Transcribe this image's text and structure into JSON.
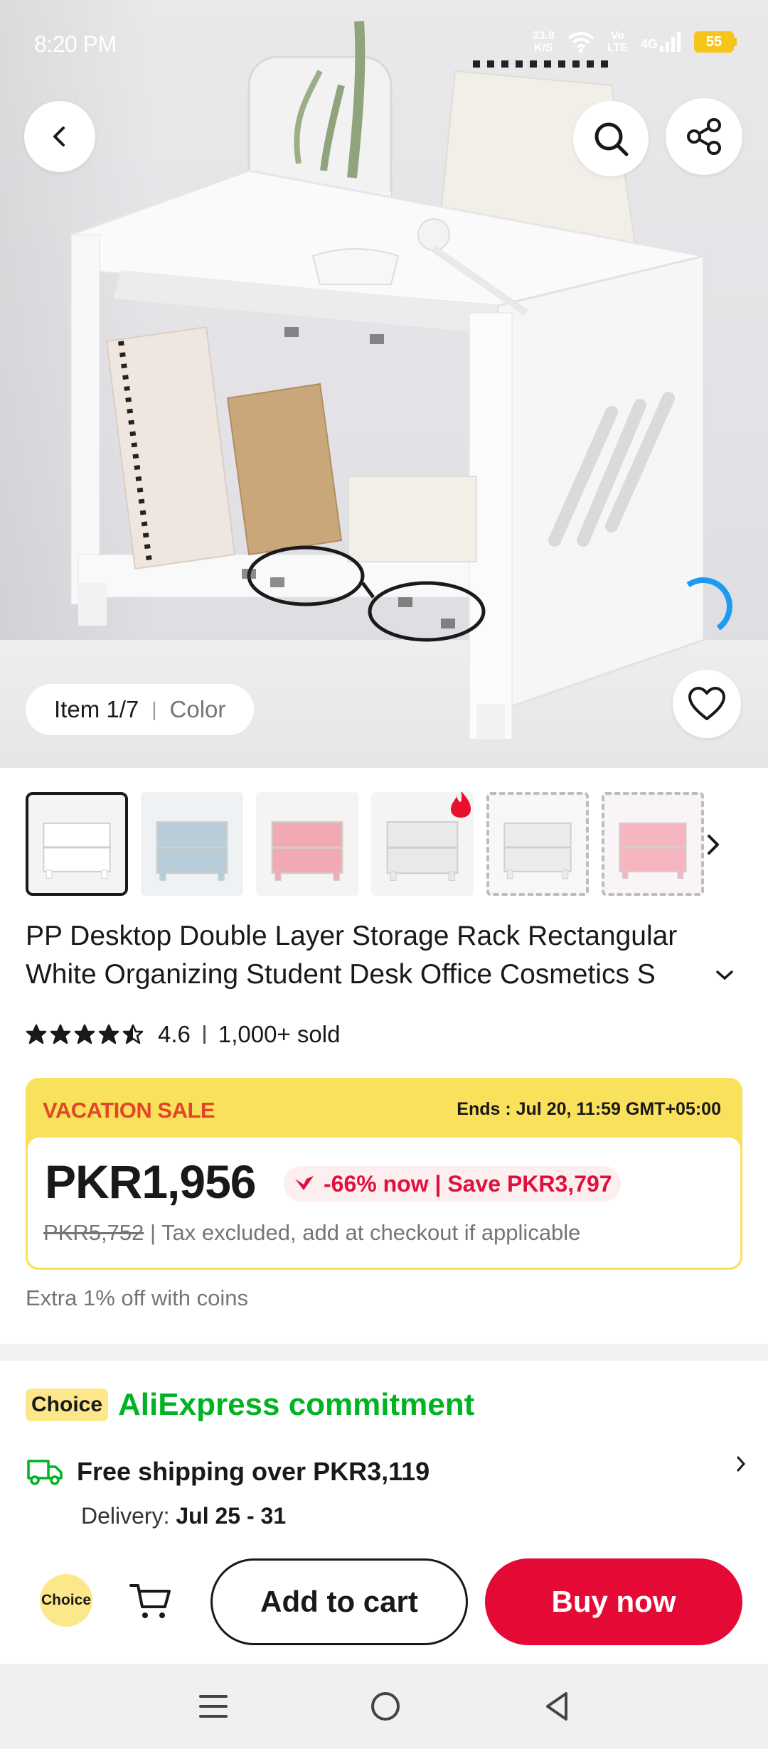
{
  "status_bar": {
    "time": "8:20 PM",
    "net_speed_value": "33.8",
    "net_speed_unit": "K/S",
    "volte_top": "Vo",
    "volte_bottom": "LTE",
    "network": "4G",
    "battery": "55"
  },
  "hero": {
    "item_count": "Item 1/7",
    "item_color": "Color"
  },
  "thumbnails": [
    {
      "color": "#f4f4f4",
      "shelf": "#ffffff",
      "selected": true,
      "dashed": false,
      "hot": false
    },
    {
      "color": "#eef2f5",
      "shelf": "#b8cdd9",
      "selected": false,
      "dashed": false,
      "hot": false
    },
    {
      "color": "#f6f3f3",
      "shelf": "#f1a9b2",
      "selected": false,
      "dashed": false,
      "hot": false
    },
    {
      "color": "#f4f4f4",
      "shelf": "#e9e9e9",
      "selected": false,
      "dashed": false,
      "hot": true
    },
    {
      "color": "#f7f7f7",
      "shelf": "#ececec",
      "selected": false,
      "dashed": true,
      "hot": false
    },
    {
      "color": "#f9f4f5",
      "shelf": "#f5b6c0",
      "selected": false,
      "dashed": true,
      "hot": false
    }
  ],
  "product": {
    "title": "PP Desktop Double Layer Storage Rack Rectangular White Organizing Student Desk Office Cosmetics S",
    "rating": "4.6",
    "rating_stars": 4.5,
    "sold": "1,000+ sold"
  },
  "sale": {
    "label": "VACATION SALE",
    "ends": "Ends :  Jul 20, 11:59 GMT+05:00",
    "price": "PKR1,956",
    "discount": "-66% now | Save PKR3,797",
    "original_price": "PKR5,752",
    "tax_note": " | Tax excluded, add at checkout if applicable"
  },
  "coins_note": "Extra 1% off with coins",
  "commitment": {
    "badge": "Choice",
    "title": "AliExpress commitment",
    "shipping": "Free shipping over PKR3,119",
    "delivery_label": "Delivery: ",
    "delivery_dates": "Jul 25 - 31"
  },
  "actions": {
    "choice": "Choice",
    "add_to_cart": "Add to cart",
    "buy_now": "Buy now"
  },
  "colors": {
    "sale_yellow": "#f9e15b",
    "sale_red": "#e2462a",
    "buy_red": "#e40a35",
    "choice_green": "#00b322",
    "choice_badge": "#fce88a"
  }
}
